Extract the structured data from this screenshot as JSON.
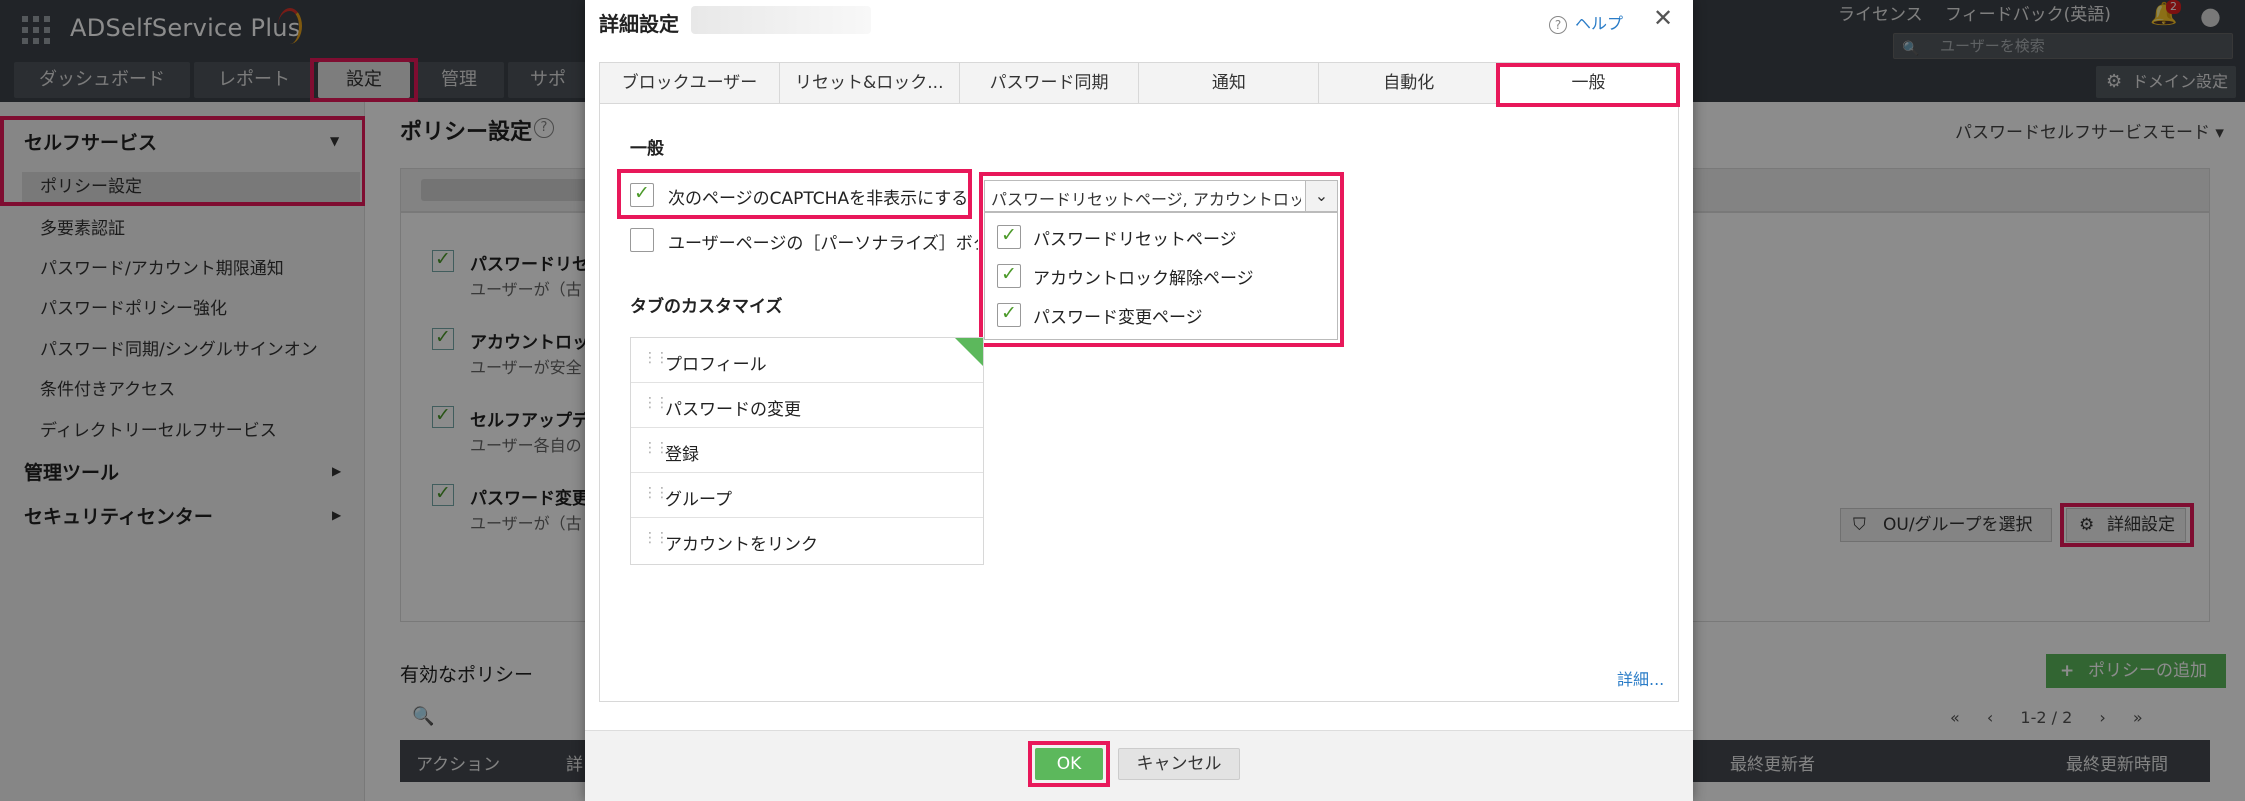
{
  "app": {
    "logo": "ADSelfService Plus",
    "top_links": [
      "ライセンス",
      "フィードバック(英語)"
    ],
    "search_placeholder": "ユーザーを検索",
    "notification_count": "2",
    "nav_tabs": [
      "ダッシュボード",
      "レポート",
      "設定",
      "管理",
      "サポ"
    ],
    "active_nav": "設定",
    "domain_button": "ドメイン設定"
  },
  "sidebar": {
    "sections": [
      {
        "label": "セルフサービス",
        "expanded": true
      },
      {
        "label": "管理ツール",
        "expanded": false
      },
      {
        "label": "セキュリティセンター",
        "expanded": false
      }
    ],
    "items": [
      "ポリシー設定",
      "多要素認証",
      "パスワード/アカウント期限通知",
      "パスワードポリシー強化",
      "パスワード同期/シングルサインオン",
      "条件付きアクセス",
      "ディレクトリーセルフサービス"
    ]
  },
  "main": {
    "title": "ポリシー設定",
    "mode_select": "パスワードセルフサービスモード",
    "policies": [
      {
        "title": "パスワードリセ",
        "sub": "ユーザーが（古"
      },
      {
        "title": "アカウントロッ",
        "sub": "ユーザーが安全"
      },
      {
        "title": "セルフアップデ",
        "sub": "ユーザー各自の"
      },
      {
        "title": "パスワード変更",
        "sub": "ユーザーが（古"
      }
    ],
    "ou_button": "OU/グループを選択",
    "advanced_button": "詳細設定",
    "active_policies_title": "有効なポリシー",
    "add_policy_button": "ポリシーの追加",
    "pager_text": "1-2 / 2",
    "table_headers": [
      "アクション",
      "詳",
      "最終更新者",
      "最終更新時間"
    ]
  },
  "dialog": {
    "title": "詳細設定",
    "help": "ヘルプ",
    "tabs": [
      "ブロックユーザー",
      "リセット&ロック...",
      "パスワード同期",
      "通知",
      "自動化",
      "一般"
    ],
    "active_tab": "一般",
    "general_section": "一般",
    "captcha_label": "次のページのCAPTCHAを非表示にする",
    "captcha_checked": true,
    "captcha_dropdown_value": "パスワードリセットページ, アカウントロック",
    "captcha_options": [
      {
        "label": "パスワードリセットページ",
        "checked": true
      },
      {
        "label": "アカウントロック解除ページ",
        "checked": true
      },
      {
        "label": "パスワード変更ページ",
        "checked": true
      }
    ],
    "personalize_label": "ユーザーページの［パーソナライズ］ボタ",
    "personalize_checked": false,
    "tab_customize_section": "タブのカスタマイズ",
    "tab_list": [
      "プロフィール",
      "パスワードの変更",
      "登録",
      "グループ",
      "アカウントをリンク"
    ],
    "more_link": "詳細...",
    "ok": "OK",
    "cancel": "キャンセル"
  },
  "colors": {
    "accent_green": "#5cb85c",
    "highlight_pink": "#e8185a",
    "link_blue": "#2a7cc7",
    "header_dark": "#3d4249"
  }
}
